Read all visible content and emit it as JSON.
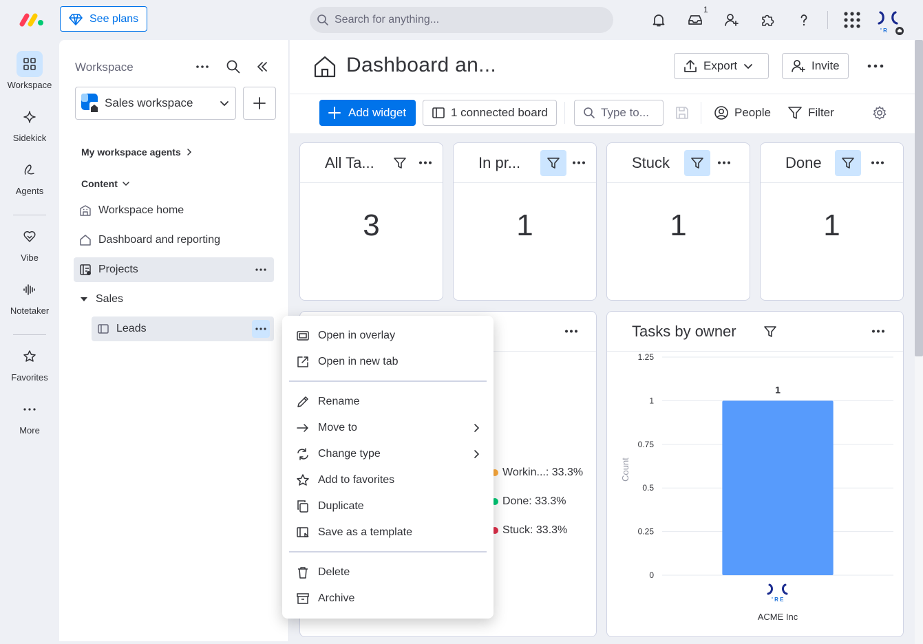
{
  "topbar": {
    "see_plans": "See plans",
    "search_placeholder": "Search for anything...",
    "inbox_count": "1"
  },
  "rail": {
    "workspace": "Workspace",
    "sidekick": "Sidekick",
    "agents": "Agents",
    "vibe": "Vibe",
    "notetaker": "Notetaker",
    "favorites": "Favorites",
    "more": "More"
  },
  "sidebar": {
    "title": "Workspace",
    "workspace_name": "Sales workspace",
    "agents_link": "My workspace agents",
    "content_label": "Content",
    "items": {
      "home": "Workspace home",
      "dashboard": "Dashboard and reporting",
      "projects": "Projects",
      "sales": "Sales",
      "leads": "Leads"
    }
  },
  "main": {
    "title": "Dashboard an...",
    "export": "Export",
    "invite": "Invite",
    "add_widget": "Add widget",
    "connected": "1 connected board",
    "type_placeholder": "Type to...",
    "people": "People",
    "filter": "Filter"
  },
  "widgets": [
    {
      "title": "All Ta...",
      "value": "3"
    },
    {
      "title": "In pr...",
      "value": "1"
    },
    {
      "title": "Stuck",
      "value": "1"
    },
    {
      "title": "Done",
      "value": "1"
    }
  ],
  "pie_legend": [
    {
      "label": "Workin...: 33.3%",
      "color": "#fdab3d"
    },
    {
      "label": "Done: 33.3%",
      "color": "#00c875"
    },
    {
      "label": "Stuck: 33.3%",
      "color": "#df2f4a"
    }
  ],
  "chart_data": {
    "type": "bar",
    "title": "Tasks by owner",
    "categories": [
      "ACME Inc"
    ],
    "values": [
      1
    ],
    "ylabel": "Count",
    "xlabel": "",
    "ylim": [
      0,
      1.25
    ],
    "yticks": [
      "1.25",
      "1",
      "0.75",
      "0.5",
      "0.25",
      "0"
    ],
    "grid": true,
    "bar_color": "#579bfc",
    "data_labels": [
      "1"
    ]
  },
  "context_menu": {
    "open_overlay": "Open in overlay",
    "open_tab": "Open in new tab",
    "rename": "Rename",
    "move_to": "Move to",
    "change_type": "Change type",
    "add_favorites": "Add to favorites",
    "duplicate": "Duplicate",
    "save_template": "Save as a template",
    "delete": "Delete",
    "archive": "Archive"
  },
  "colors": {
    "accent": "#0073ea",
    "selected_bg": "#cce5ff"
  }
}
